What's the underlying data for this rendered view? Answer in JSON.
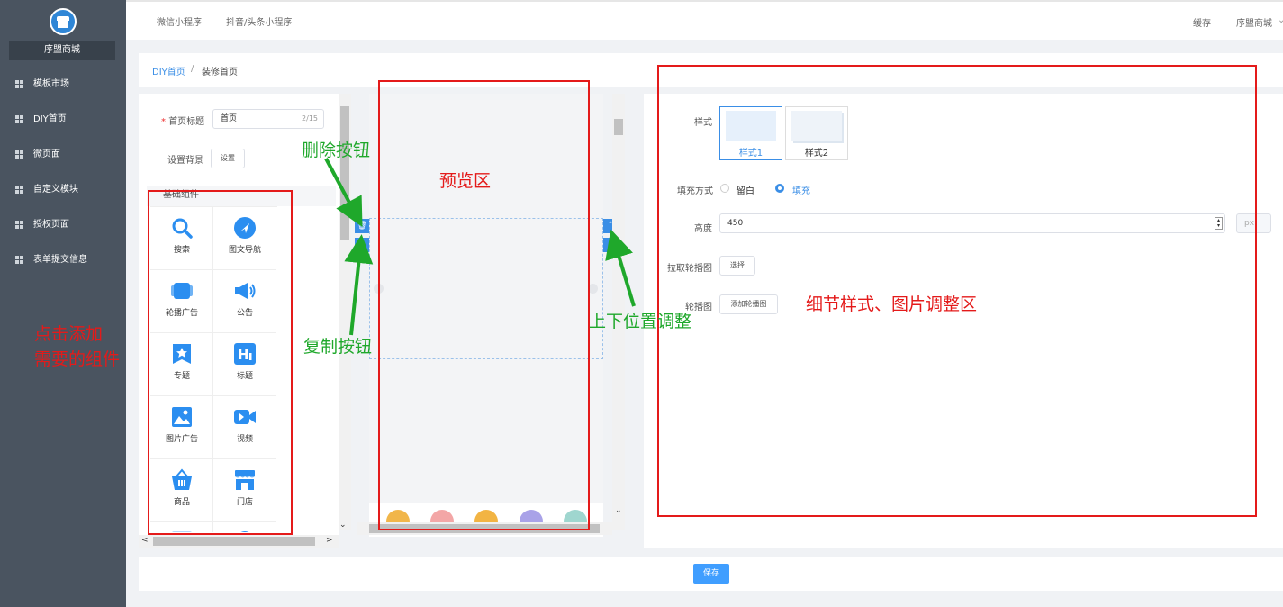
{
  "sidebar": {
    "brand": "序盟商城",
    "items": [
      {
        "label": "模板市场"
      },
      {
        "label": "DIY首页"
      },
      {
        "label": "微页面"
      },
      {
        "label": "自定义模块"
      },
      {
        "label": "授权页面"
      },
      {
        "label": "表单提交信息"
      }
    ]
  },
  "topbar": {
    "tabs": [
      "微信小程序",
      "抖音/头条小程序"
    ],
    "cache": "缓存",
    "user": "序盟商城"
  },
  "breadcrumb": {
    "first": "DIY首页",
    "sep": "/",
    "current": "装修首页"
  },
  "form": {
    "title_label": "首页标题",
    "title_required": "*",
    "title_value": "首页",
    "title_count": "2/15",
    "bg_label": "设置背景",
    "bg_button": "设置"
  },
  "components": {
    "heading": "基础组件",
    "items": [
      {
        "label": "搜索",
        "icon": "search-icon"
      },
      {
        "label": "图文导航",
        "icon": "navigation-icon"
      },
      {
        "label": "轮播广告",
        "icon": "carousel-icon"
      },
      {
        "label": "公告",
        "icon": "announcement-icon"
      },
      {
        "label": "专题",
        "icon": "topic-icon"
      },
      {
        "label": "标题",
        "icon": "heading-icon"
      },
      {
        "label": "图片广告",
        "icon": "image-ad-icon"
      },
      {
        "label": "视频",
        "icon": "video-icon"
      },
      {
        "label": "商品",
        "icon": "goods-icon"
      },
      {
        "label": "门店",
        "icon": "store-icon"
      }
    ]
  },
  "settings": {
    "style_label": "样式",
    "styles": [
      "样式1",
      "样式2"
    ],
    "fill_label": "填充方式",
    "fill_options": [
      "留白",
      "填充"
    ],
    "fill_selected": "填充",
    "height_label": "高度",
    "height_value": "450",
    "height_unit": "px",
    "pull_label": "拉取轮播图",
    "pull_button": "选择",
    "carousel_label": "轮播图",
    "carousel_button": "添加轮播图"
  },
  "footer": {
    "save": "保存"
  },
  "annotations": {
    "delete": "删除按钮",
    "preview": "预览区",
    "copy": "复制按钮",
    "move": "上下位置调整",
    "detail": "细节样式、图片调整区",
    "add_line1": "点击添加",
    "add_line2": "需要的组件"
  },
  "colors": {
    "accent": "#3a8ee6",
    "annotation_red": "#e41a1a",
    "annotation_green": "#1fa82b",
    "sidebar": "#4a5460"
  }
}
